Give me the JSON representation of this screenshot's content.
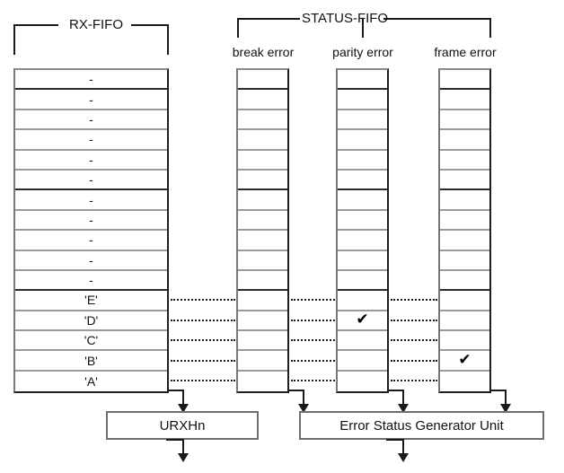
{
  "diagram": {
    "title": "UART RX FIFO and Status FIFO diagram",
    "groups": {
      "rx_fifo": {
        "label": "RX-FIFO"
      },
      "status_fifo": {
        "label": "STATUS-FIFO"
      }
    },
    "columns": [
      {
        "id": "rx-fifo",
        "header": "",
        "cells": [
          "-",
          "-",
          "-",
          "-",
          "-",
          "-",
          "-",
          "-",
          "-",
          "-",
          "-",
          "'E'",
          "'D'",
          "'C'",
          "'B'",
          "'A'"
        ]
      },
      {
        "id": "break-error",
        "header": "break error",
        "cells": [
          "",
          "",
          "",
          "",
          "",
          "",
          "",
          "",
          "",
          "",
          "",
          "",
          "",
          "",
          "",
          ""
        ]
      },
      {
        "id": "parity-error",
        "header": "parity error",
        "cells": [
          "",
          "",
          "",
          "",
          "",
          "",
          "",
          "",
          "",
          "",
          "",
          "",
          "✔",
          "",
          "",
          ""
        ]
      },
      {
        "id": "frame-error",
        "header": "frame error",
        "cells": [
          "",
          "",
          "",
          "",
          "",
          "",
          "",
          "",
          "",
          "",
          "",
          "",
          "",
          "",
          "✔",
          ""
        ]
      }
    ],
    "units": [
      {
        "id": "urxhn",
        "label": "URXHn"
      },
      {
        "id": "error-status-generator-unit",
        "label": "Error Status Generator Unit"
      }
    ],
    "colors": {
      "line": "#1a1a1a",
      "cell_border": "#9a9a9a",
      "box_border": "#6e6e6e",
      "text": "#111111",
      "background": "#ffffff"
    },
    "checkmark_glyph": "✔"
  }
}
